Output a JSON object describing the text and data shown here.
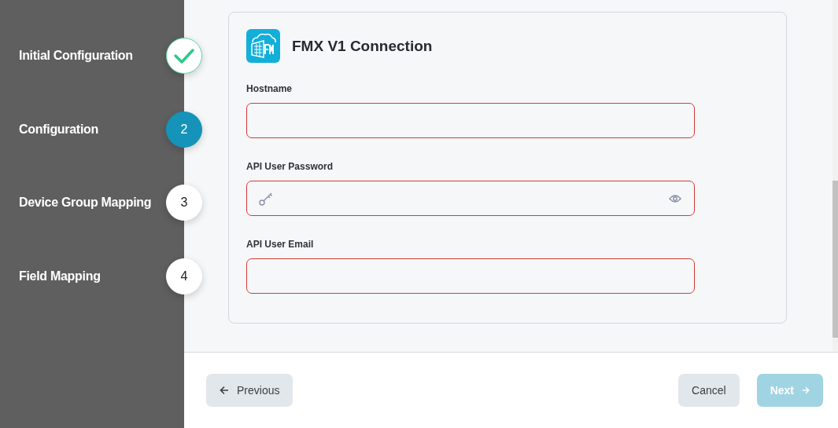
{
  "steps": [
    {
      "label": "Initial Configuration",
      "completed": true,
      "selected": false
    },
    {
      "label": "Configuration",
      "number": "2",
      "completed": false,
      "selected": true
    },
    {
      "label": "Device Group Mapping",
      "number": "3",
      "completed": false,
      "selected": false
    },
    {
      "label": "Field Mapping",
      "number": "4",
      "completed": false,
      "selected": false
    }
  ],
  "card": {
    "title": "FMX V1 Connection"
  },
  "fields": [
    {
      "label": "Hostname",
      "kind": "text",
      "invalid": true
    },
    {
      "label": "API User Password",
      "kind": "password",
      "invalid": true
    },
    {
      "label": "API User Email",
      "kind": "text",
      "invalid": true
    }
  ],
  "footer": {
    "previous": {
      "label": "Previous"
    },
    "cancel": {
      "label": "Cancel"
    },
    "next": {
      "label": "Next",
      "disabled": true
    }
  }
}
